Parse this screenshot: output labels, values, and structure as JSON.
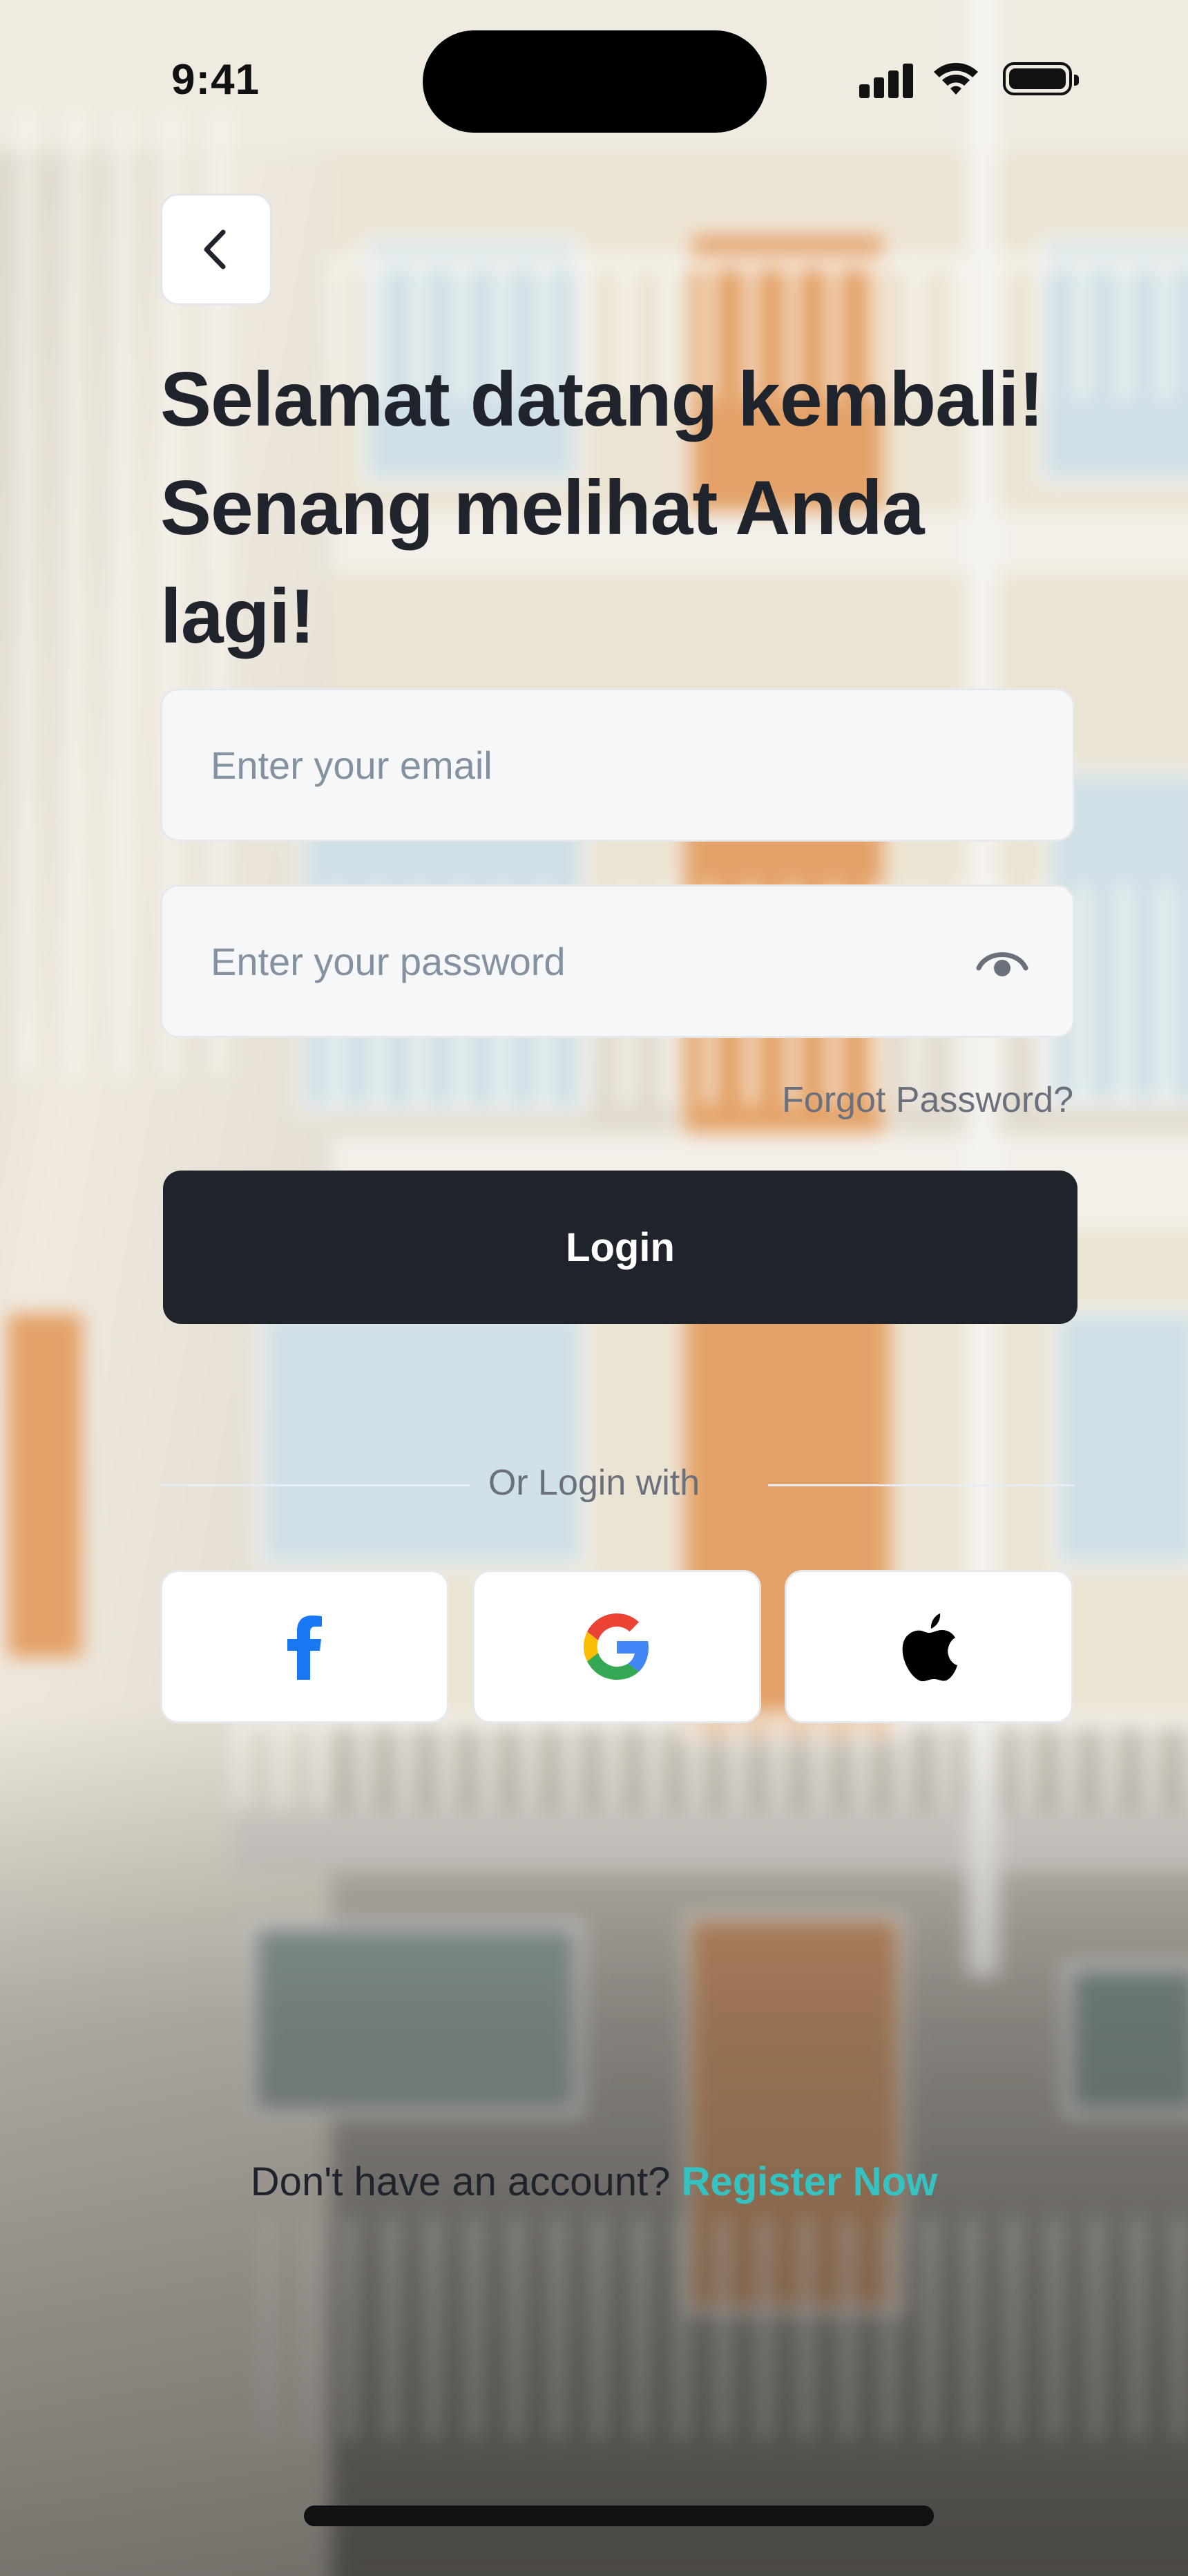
{
  "status_bar": {
    "time": "9:41"
  },
  "header": {
    "title": "Selamat datang kembali! Senang melihat Anda lagi!"
  },
  "form": {
    "email_placeholder": "Enter your email",
    "password_placeholder": "Enter your password",
    "forgot_password": "Forgot Password?",
    "login_label": "Login"
  },
  "social": {
    "divider_text": "Or Login with",
    "providers": [
      "facebook",
      "google",
      "apple"
    ]
  },
  "footer": {
    "prompt": "Don't have an account?",
    "register_label": "Register Now"
  },
  "colors": {
    "primary": "#1E232C",
    "accent": "#35C2C1",
    "muted_text": "#6A707C",
    "placeholder": "#8391A1",
    "field_bg": "#F6F7F9",
    "facebook": "#1877F2"
  },
  "icons": [
    "back-chevron-icon",
    "eye-icon",
    "facebook-icon",
    "google-icon",
    "apple-icon"
  ]
}
